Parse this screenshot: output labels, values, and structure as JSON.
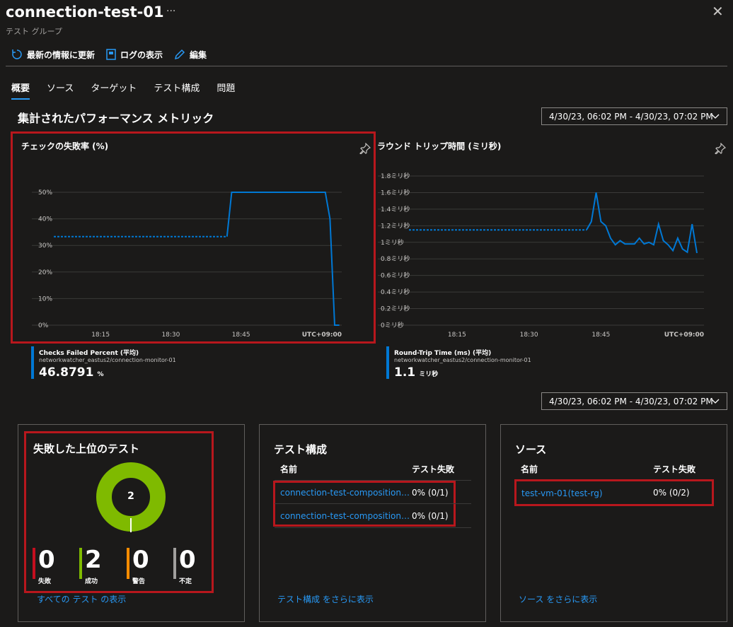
{
  "header": {
    "title": "connection-test-01",
    "subtitle": "テスト グループ"
  },
  "toolbar": {
    "refresh_label": "最新の情報に更新",
    "logs_label": "ログの表示",
    "edit_label": "編集"
  },
  "tabs": [
    {
      "label": "概要",
      "active": true
    },
    {
      "label": "ソース"
    },
    {
      "label": "ターゲット"
    },
    {
      "label": "テスト構成"
    },
    {
      "label": "問題"
    }
  ],
  "metrics": {
    "section_title": "集計されたパフォーマンス メトリック",
    "time_range": "4/30/23, 06:02 PM - 4/30/23, 07:02 PM"
  },
  "chart_data": [
    {
      "type": "line",
      "title": "チェックの失敗率 (%)",
      "y_ticks": [
        "0%",
        "10%",
        "20%",
        "30%",
        "40%",
        "50%"
      ],
      "ylim": [
        0,
        50
      ],
      "x_ticks": [
        "18:15",
        "18:30",
        "18:45"
      ],
      "timezone": "UTC+09:00",
      "xlim": [
        0,
        60
      ],
      "series": [
        {
          "name": "Checks Failed Percent (平均)",
          "source": "networkwatcher_eastus2/connection-monitor-01",
          "value": "46.8791",
          "unit": "%",
          "dashed_segment": [
            [
              0,
              33.3
            ],
            [
              37,
              33.3
            ]
          ],
          "solid_segment": [
            [
              37,
              33.3
            ],
            [
              38,
              50
            ],
            [
              58,
              50
            ],
            [
              59,
              40
            ],
            [
              60,
              0
            ],
            [
              61,
              0
            ]
          ]
        }
      ]
    },
    {
      "type": "line",
      "title": "ラウンド トリップ時間 (ミリ秒)",
      "y_ticks": [
        "0ミリ秒",
        "0.2ミリ秒",
        "0.4ミリ秒",
        "0.6ミリ秒",
        "0.8ミリ秒",
        "1ミリ秒",
        "1.2ミリ秒",
        "1.4ミリ秒",
        "1.6ミリ秒",
        "1.8ミリ秒"
      ],
      "ylim": [
        0,
        1.8
      ],
      "x_ticks": [
        "18:15",
        "18:30",
        "18:45"
      ],
      "timezone": "UTC+09:00",
      "xlim": [
        0,
        60
      ],
      "series": [
        {
          "name": "Round-Trip Time (ms) (平均)",
          "source": "networkwatcher_eastus2/connection-monitor-01",
          "value": "1.1",
          "unit": "ミリ秒",
          "dashed_segment": [
            [
              0,
              1.15
            ],
            [
              37,
              1.15
            ]
          ],
          "solid_segment": [
            [
              37,
              1.15
            ],
            [
              38,
              1.25
            ],
            [
              39,
              1.6
            ],
            [
              40,
              1.25
            ],
            [
              41,
              1.2
            ],
            [
              42,
              1.05
            ],
            [
              43,
              0.97
            ],
            [
              44,
              1.02
            ],
            [
              45,
              0.98
            ],
            [
              46,
              0.98
            ],
            [
              47,
              0.98
            ],
            [
              48,
              1.05
            ],
            [
              49,
              0.98
            ],
            [
              50,
              1.0
            ],
            [
              51,
              0.97
            ],
            [
              52,
              1.22
            ],
            [
              53,
              1.02
            ],
            [
              54,
              0.97
            ],
            [
              55,
              0.9
            ],
            [
              56,
              1.05
            ],
            [
              57,
              0.92
            ],
            [
              58,
              0.88
            ],
            [
              59,
              1.22
            ],
            [
              60,
              0.87
            ]
          ]
        }
      ]
    }
  ],
  "range2": "4/30/23, 06:02 PM - 4/30/23, 07:02 PM",
  "top_failed": {
    "title": "失敗した上位のテスト",
    "donut_center": "2",
    "stats": [
      {
        "value": "0",
        "label": "失敗",
        "color": "#c50f1f"
      },
      {
        "value": "2",
        "label": "成功",
        "color": "#7fba00"
      },
      {
        "value": "0",
        "label": "警告",
        "color": "#ff8c00"
      },
      {
        "value": "0",
        "label": "不定",
        "color": "#a19f9d"
      }
    ],
    "link": "すべての テスト の表示"
  },
  "test_config": {
    "title": "テスト構成",
    "col_name": "名前",
    "col_fail": "テスト失敗",
    "rows": [
      {
        "name": "connection-test-composition…",
        "fail": "0% (0/1)"
      },
      {
        "name": "connection-test-composition…",
        "fail": "0% (0/1)"
      }
    ],
    "link": "テスト構成 をさらに表示"
  },
  "sources": {
    "title": "ソース",
    "col_name": "名前",
    "col_fail": "テスト失敗",
    "rows": [
      {
        "name": "test-vm-01(test-rg)",
        "fail": "0% (0/2)"
      }
    ],
    "link": "ソース をさらに表示"
  },
  "colors": {
    "accent": "#2899f5",
    "line": "#0078d4",
    "highlight": "#b8171d",
    "success": "#7fba00"
  }
}
